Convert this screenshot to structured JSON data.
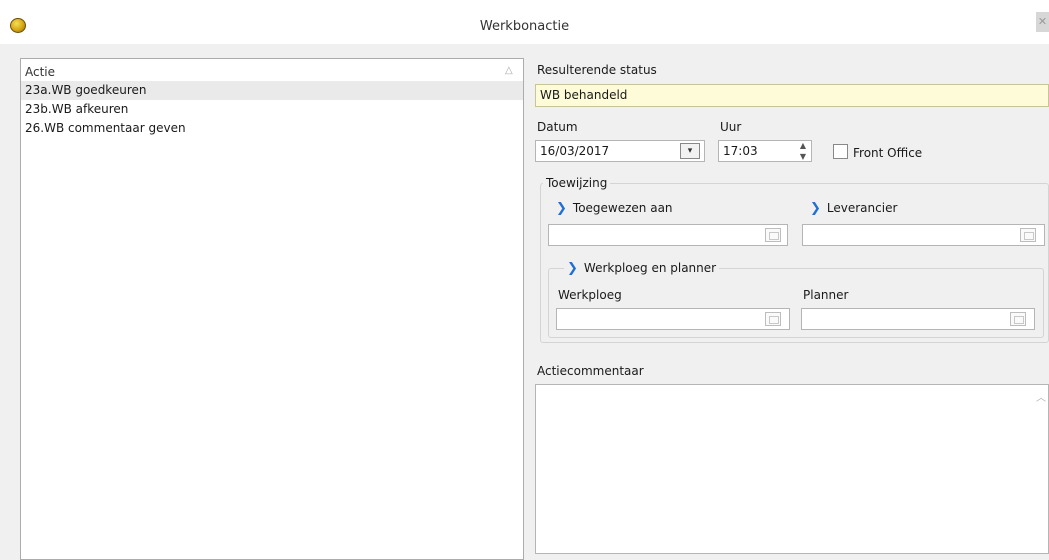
{
  "window": {
    "title": "Werkbonactie",
    "close_glyph": "✕"
  },
  "actions": {
    "header": "Actie",
    "items": [
      "23a.WB goedkeuren",
      "23b.WB afkeuren",
      "26.WB commentaar geven"
    ]
  },
  "status": {
    "label": "Resulterende status",
    "value": "WB behandeld"
  },
  "datetime": {
    "date_label": "Datum",
    "date_value": "16/03/2017",
    "time_label": "Uur",
    "time_value": "17:03",
    "front_office_label": "Front Office",
    "front_office_checked": false
  },
  "assignment": {
    "group_label": "Toewijzing",
    "assigned_to_label": "Toegewezen aan",
    "assigned_to_value": "",
    "supplier_label": "Leverancier",
    "supplier_value": "",
    "crew_group_label": "Werkploeg en planner",
    "crew_label": "Werkploeg",
    "crew_value": "",
    "planner_label": "Planner",
    "planner_value": ""
  },
  "comment": {
    "label": "Actiecommentaar",
    "value": ""
  },
  "icons": {
    "app": "app-logo-icon",
    "sort": "sort-indicator-icon",
    "calendar": "calendar-dropdown-icon",
    "spin": "time-spinner-icon",
    "lookup": "lookup-icon",
    "expand": "chevron-right-icon"
  },
  "colors": {
    "status_field": "#fdfbd8",
    "selected_row": "#eaeaea",
    "chevron": "#1f6fd6"
  }
}
